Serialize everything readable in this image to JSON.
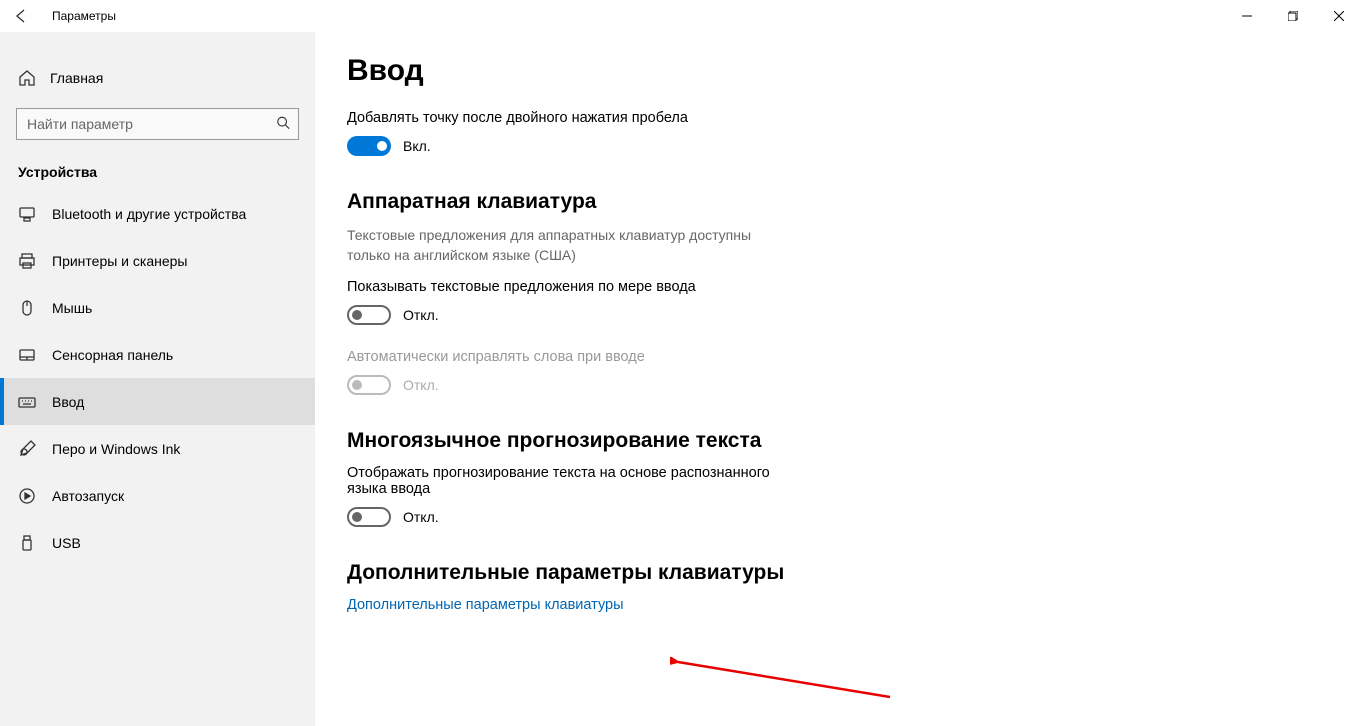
{
  "app_title": "Параметры",
  "home_label": "Главная",
  "search_placeholder": "Найти параметр",
  "section": "Устройства",
  "nav": [
    {
      "id": "bluetooth",
      "label": "Bluetooth и другие устройства"
    },
    {
      "id": "printers",
      "label": "Принтеры и сканеры"
    },
    {
      "id": "mouse",
      "label": "Мышь"
    },
    {
      "id": "touchpad",
      "label": "Сенсорная панель"
    },
    {
      "id": "typing",
      "label": "Ввод"
    },
    {
      "id": "pen",
      "label": "Перо и Windows Ink"
    },
    {
      "id": "autoplay",
      "label": "Автозапуск"
    },
    {
      "id": "usb",
      "label": "USB"
    }
  ],
  "page_title": "Ввод",
  "setting1": {
    "label": "Добавлять точку после двойного нажатия пробела",
    "state": "Вкл."
  },
  "hw_section": {
    "title": "Аппаратная клавиатура",
    "desc": "Текстовые предложения для аппаратных клавиатур доступны только на английском языке (США)",
    "opt1_label": "Показывать текстовые предложения по мере ввода",
    "opt1_state": "Откл.",
    "opt2_label": "Автоматически исправлять слова при вводе",
    "opt2_state": "Откл."
  },
  "multilang": {
    "title": "Многоязычное прогнозирование текста",
    "desc": "Отображать прогнозирование текста на основе распознанного языка ввода",
    "state": "Откл."
  },
  "advanced": {
    "title": "Дополнительные параметры клавиатуры",
    "link": "Дополнительные параметры клавиатуры"
  }
}
